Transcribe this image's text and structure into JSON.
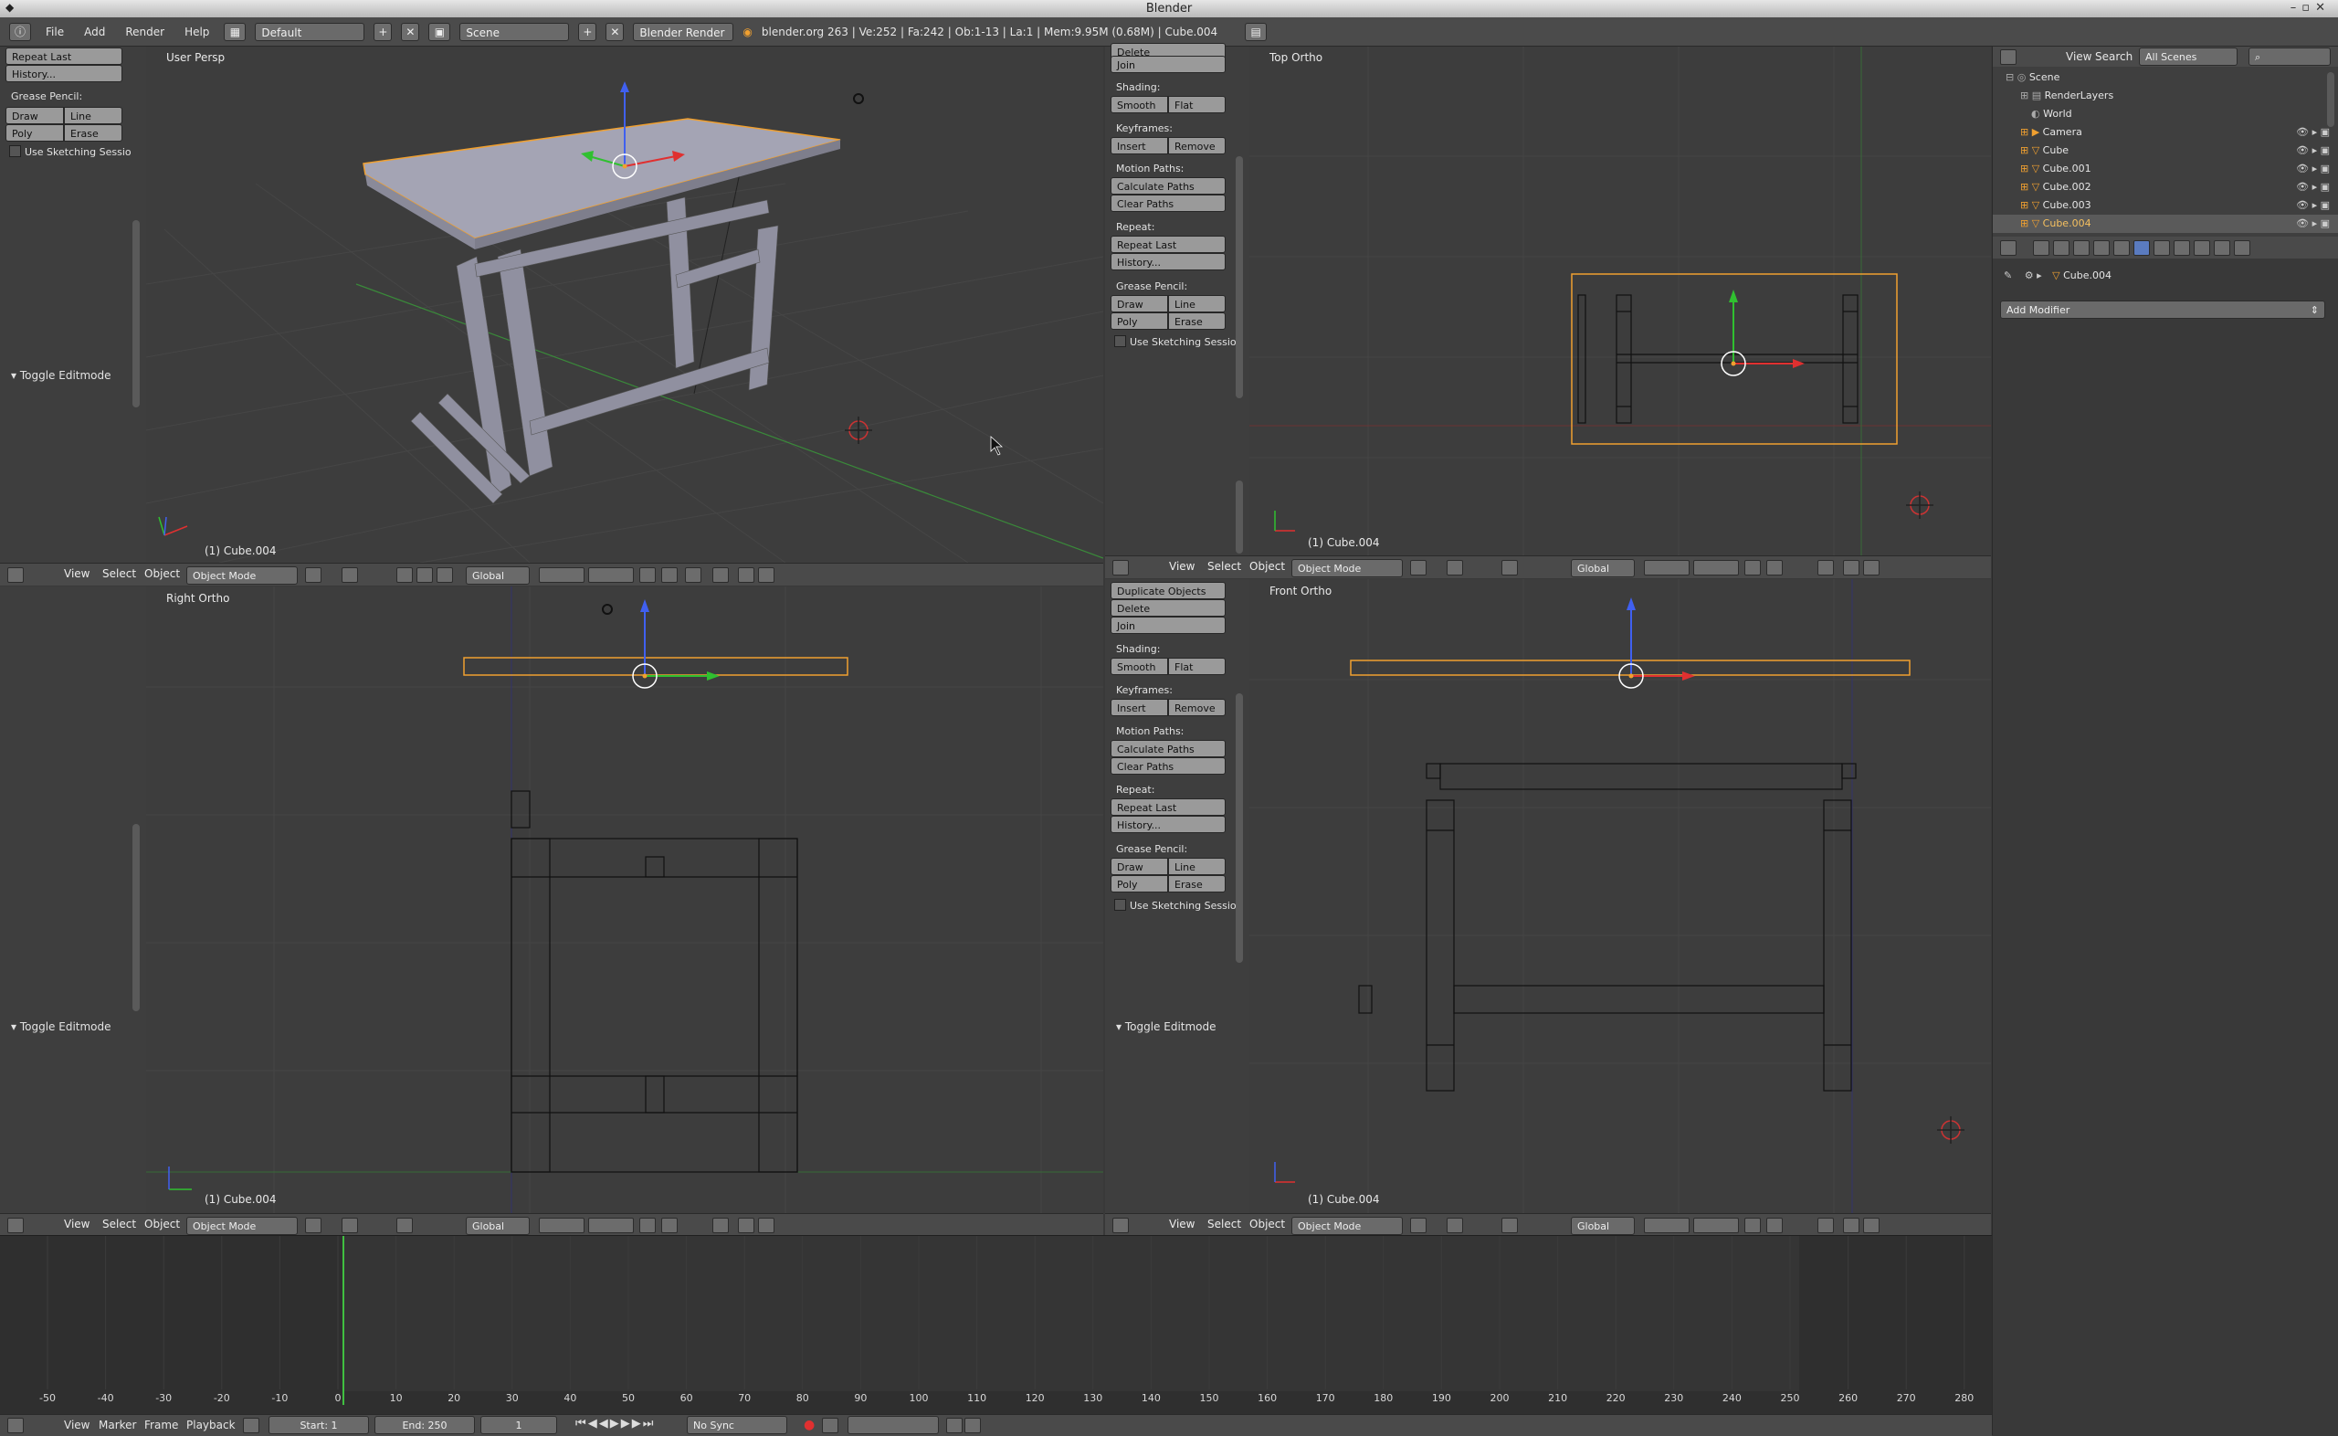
{
  "window": {
    "title": "Blender"
  },
  "info_header": {
    "menus": [
      "File",
      "Add",
      "Render",
      "Help"
    ],
    "layout": "Default",
    "scene": "Scene",
    "engine": "Blender Render",
    "stats": "blender.org 263 | Ve:252 | Fa:242 | Ob:1-13 | La:1 | Mem:9.95M (0.68M) | Cube.004"
  },
  "viewports": {
    "top_left": {
      "label": "User Persp",
      "object": "(1) Cube.004"
    },
    "top_right": {
      "label": "Top Ortho",
      "object": "(1) Cube.004"
    },
    "bottom_left": {
      "label": "Right Ortho",
      "object": "(1) Cube.004"
    },
    "bottom_right": {
      "label": "Front Ortho",
      "object": "(1) Cube.004"
    }
  },
  "tool_shelf_topleft": {
    "repeat_last": "Repeat Last",
    "history": "History...",
    "grease_pencil": "Grease Pencil:",
    "draw": "Draw",
    "line": "Line",
    "poly": "Poly",
    "erase": "Erase",
    "use_sketching": "Use Sketching Sessio",
    "toggle_editmode": "Toggle Editmode"
  },
  "tool_shelf_right": {
    "delete": "Delete",
    "duplicate_objects": "Duplicate Objects",
    "join": "Join",
    "shading": "Shading:",
    "smooth": "Smooth",
    "flat": "Flat",
    "keyframes": "Keyframes:",
    "insert": "Insert",
    "remove": "Remove",
    "motion_paths": "Motion Paths:",
    "calculate_paths": "Calculate Paths",
    "clear_paths": "Clear Paths",
    "repeat": "Repeat:",
    "repeat_last": "Repeat Last",
    "history": "History...",
    "grease_pencil": "Grease Pencil:",
    "draw": "Draw",
    "line": "Line",
    "poly": "Poly",
    "erase": "Erase",
    "use_sketching": "Use Sketching Sessio",
    "toggle_editmode": "Toggle Editmode"
  },
  "view_header": {
    "view": "View",
    "select": "Select",
    "object": "Object",
    "mode": "Object Mode",
    "orientation": "Global"
  },
  "outliner": {
    "view": "View",
    "search": "Search",
    "filter": "All Scenes",
    "items": [
      "Scene",
      "RenderLayers",
      "World",
      "Camera",
      "Cube",
      "Cube.001",
      "Cube.002",
      "Cube.003",
      "Cube.004"
    ]
  },
  "properties": {
    "object_name": "Cube.004",
    "add_modifier": "Add Modifier"
  },
  "timeline": {
    "ruler": [
      "-50",
      "-40",
      "-30",
      "-20",
      "-10",
      "0",
      "10",
      "20",
      "30",
      "40",
      "50",
      "60",
      "70",
      "80",
      "90",
      "100",
      "110",
      "120",
      "130",
      "140",
      "150",
      "160",
      "170",
      "180",
      "190",
      "200",
      "210",
      "220",
      "230",
      "240",
      "250",
      "260",
      "270",
      "280"
    ],
    "menus": [
      "View",
      "Marker",
      "Frame",
      "Playback"
    ],
    "start": "Start: 1",
    "end": "End: 250",
    "current": "1",
    "sync": "No Sync"
  },
  "colors": {
    "selection": "#f0a030",
    "axis_x": "#e03030",
    "axis_y": "#30c030",
    "axis_z": "#3060e0",
    "playhead": "#40c040"
  }
}
